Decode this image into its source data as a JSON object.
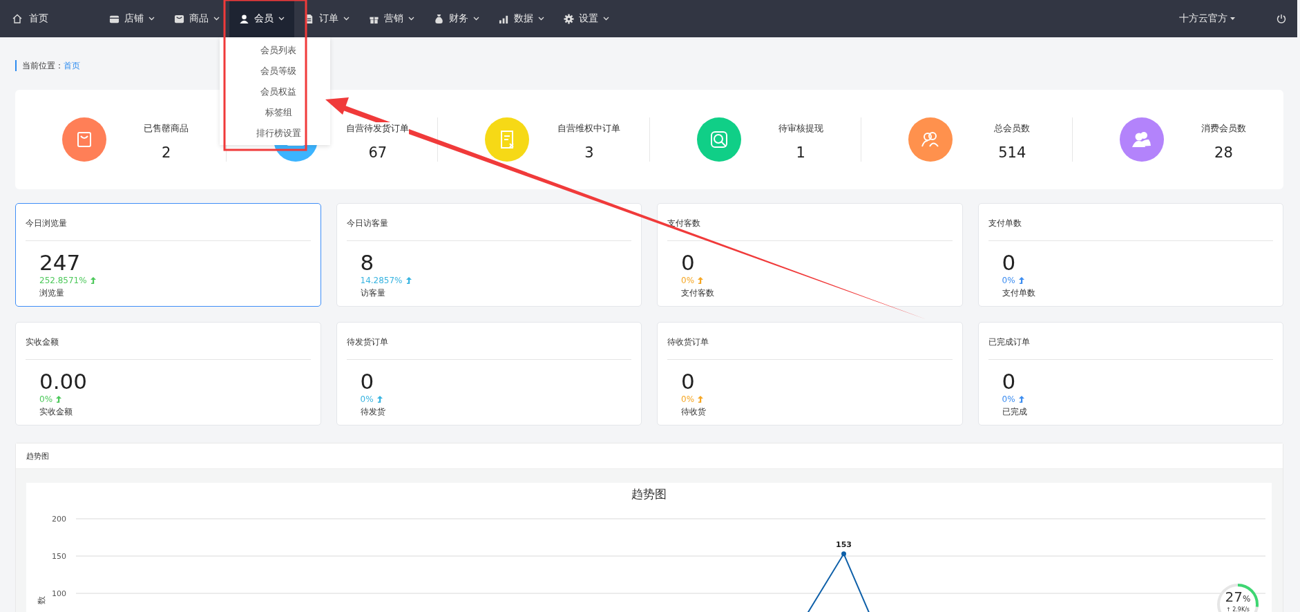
{
  "nav": {
    "home": "首页",
    "items": [
      {
        "label": "店铺",
        "selected": false
      },
      {
        "label": "商品",
        "selected": false
      },
      {
        "label": "会员",
        "selected": true
      },
      {
        "label": "订单",
        "selected": false
      },
      {
        "label": "营销",
        "selected": false
      },
      {
        "label": "财务",
        "selected": false
      },
      {
        "label": "数据",
        "selected": false
      },
      {
        "label": "设置",
        "selected": false
      }
    ],
    "user": "十方云官方"
  },
  "dropdown": {
    "items": [
      "会员列表",
      "会员等级",
      "会员权益",
      "标签组",
      "排行榜设置"
    ]
  },
  "breadcrumb": {
    "label": "当前位置：",
    "link": "首页"
  },
  "stats": [
    {
      "label": "已售罄商品",
      "value": "2",
      "color": "#ff7f57"
    },
    {
      "label": "自营待发货订单",
      "value": "67",
      "color": "#3cb4ff"
    },
    {
      "label": "自营维权中订单",
      "value": "3",
      "color": "#f6d916"
    },
    {
      "label": "待审核提现",
      "value": "1",
      "color": "#10cf87"
    },
    {
      "label": "总会员数",
      "value": "514",
      "color": "#ff914d"
    },
    {
      "label": "消费会员数",
      "value": "28",
      "color": "#b383fb"
    }
  ],
  "cards": [
    {
      "title": "今日浏览量",
      "value": "247",
      "change": "252.8571%",
      "caption": "浏览量",
      "color": "#4cc85a",
      "selected": true
    },
    {
      "title": "今日访客量",
      "value": "8",
      "change": "14.2857%",
      "caption": "访客量",
      "color": "#36b3e0",
      "selected": false
    },
    {
      "title": "支付客数",
      "value": "0",
      "change": "0%",
      "caption": "支付客数",
      "color": "#f5a623",
      "selected": false
    },
    {
      "title": "支付单数",
      "value": "0",
      "change": "0%",
      "caption": "支付单数",
      "color": "#3b8cf0",
      "selected": false
    },
    {
      "title": "实收金额",
      "value": "0.00",
      "change": "0%",
      "caption": "实收金额",
      "color": "#4cc85a",
      "selected": false
    },
    {
      "title": "待发货订单",
      "value": "0",
      "change": "0%",
      "caption": "待发货",
      "color": "#36b3e0",
      "selected": false
    },
    {
      "title": "待收货订单",
      "value": "0",
      "change": "0%",
      "caption": "待收货",
      "color": "#f5a623",
      "selected": false
    },
    {
      "title": "已完成订单",
      "value": "0",
      "change": "0%",
      "caption": "已完成",
      "color": "#3b8cf0",
      "selected": false
    }
  ],
  "trend_panel": {
    "title": "趋势图",
    "chart_data": {
      "type": "line",
      "title": "趋势图",
      "ylabel": "数",
      "ylim": [
        100,
        200
      ],
      "yticks": [
        100,
        150,
        200
      ],
      "value_labels": [
        null,
        null,
        null,
        null,
        null,
        null,
        null,
        null,
        null,
        null,
        null,
        null,
        null,
        null,
        null,
        "153",
        null,
        null,
        null,
        null,
        null,
        null,
        null,
        null
      ],
      "series": [
        {
          "color": "#0d5fa8",
          "marker": "circle",
          "values": [
            null,
            null,
            null,
            null,
            null,
            null,
            null,
            null,
            null,
            null,
            null,
            null,
            null,
            null,
            null,
            153,
            null,
            null,
            null,
            null,
            null,
            null,
            null,
            null
          ]
        }
      ]
    }
  },
  "speed_widget": {
    "percent": "27",
    "unit": "%",
    "speed": "↑ 2.9K/s",
    "level": 0.27
  }
}
